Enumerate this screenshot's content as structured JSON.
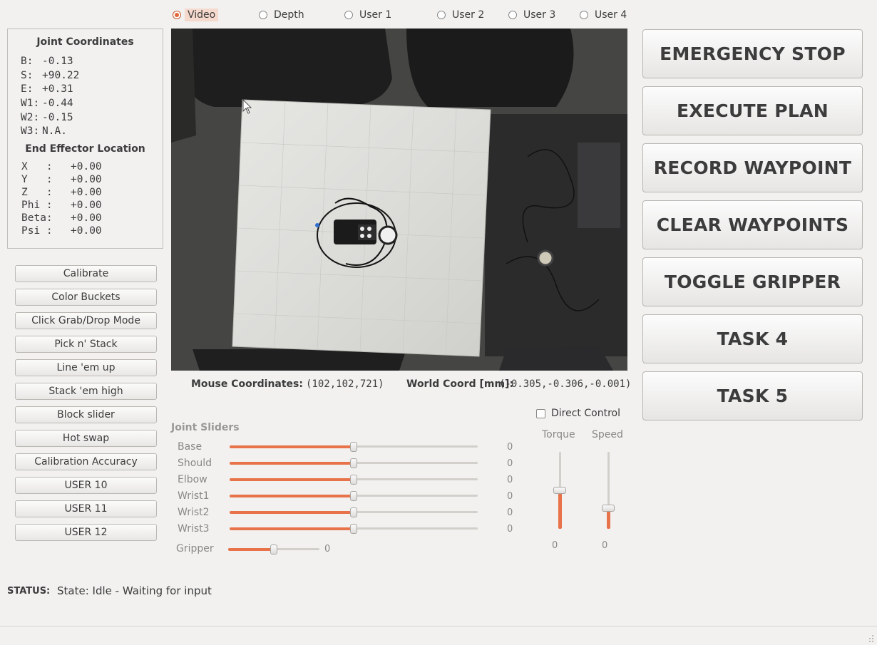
{
  "view_modes": [
    {
      "label": "Video",
      "checked": true
    },
    {
      "label": "Depth",
      "checked": false
    },
    {
      "label": "User 1",
      "checked": false
    },
    {
      "label": "User 2",
      "checked": false
    },
    {
      "label": "User 3",
      "checked": false
    },
    {
      "label": "User 4",
      "checked": false
    }
  ],
  "joint_coordinates": {
    "title": "Joint Coordinates",
    "rows": [
      {
        "label": "B:",
        "value": "-0.13"
      },
      {
        "label": "S:",
        "value": "+90.22"
      },
      {
        "label": "E:",
        "value": "+0.31"
      },
      {
        "label": "W1:",
        "value": "-0.44"
      },
      {
        "label": "W2:",
        "value": "-0.15"
      },
      {
        "label": "W3:",
        "value": "N.A."
      }
    ]
  },
  "end_effector": {
    "title": "End Effector Location",
    "rows": [
      {
        "label": "X   :",
        "value": "+0.00"
      },
      {
        "label": "Y   :",
        "value": "+0.00"
      },
      {
        "label": "Z   :",
        "value": "+0.00"
      },
      {
        "label": "Phi :",
        "value": "+0.00"
      },
      {
        "label": "Beta:",
        "value": "+0.00"
      },
      {
        "label": "Psi :",
        "value": "+0.00"
      }
    ]
  },
  "left_buttons": [
    "Calibrate",
    "Color Buckets",
    "Click Grab/Drop Mode",
    "Pick n' Stack",
    "Line 'em up",
    "Stack 'em high",
    "Block slider",
    "Hot swap",
    "Calibration Accuracy",
    "USER 10",
    "USER 11",
    "USER 12"
  ],
  "big_buttons": [
    "EMERGENCY STOP",
    "EXECUTE PLAN",
    "RECORD WAYPOINT",
    "CLEAR WAYPOINTS",
    "TOGGLE GRIPPER",
    "TASK 4",
    "TASK 5"
  ],
  "mouse": {
    "label": "Mouse Coordinates:",
    "value": "(102,102,721)"
  },
  "world": {
    "label": "World Coord [mm]:",
    "value": "(-0.305,-0.306,-0.001)"
  },
  "joint_sliders": {
    "title": "Joint Sliders",
    "rows": [
      {
        "label": "Base",
        "value": "0",
        "level": 0.5
      },
      {
        "label": "Shoulder",
        "value": "0",
        "level": 0.5
      },
      {
        "label": "Elbow",
        "value": "0",
        "level": 0.5
      },
      {
        "label": "Wrist1",
        "value": "0",
        "level": 0.5
      },
      {
        "label": "Wrist2",
        "value": "0",
        "level": 0.5
      },
      {
        "label": "Wrist3",
        "value": "0",
        "level": 0.5
      }
    ],
    "gripper": {
      "label": "Gripper",
      "value": "0",
      "level": 0.5
    }
  },
  "direct_control": {
    "label": "Direct Control",
    "checked": false
  },
  "torque": {
    "label": "Torque",
    "value": "0",
    "level": 0.5
  },
  "speed": {
    "label": "Speed",
    "value": "0",
    "level": 0.27
  },
  "status": {
    "label": "STATUS:",
    "text": "State: Idle - Waiting for input"
  },
  "colors": {
    "accent": "#e8724a",
    "background": "#f2f1f0"
  }
}
